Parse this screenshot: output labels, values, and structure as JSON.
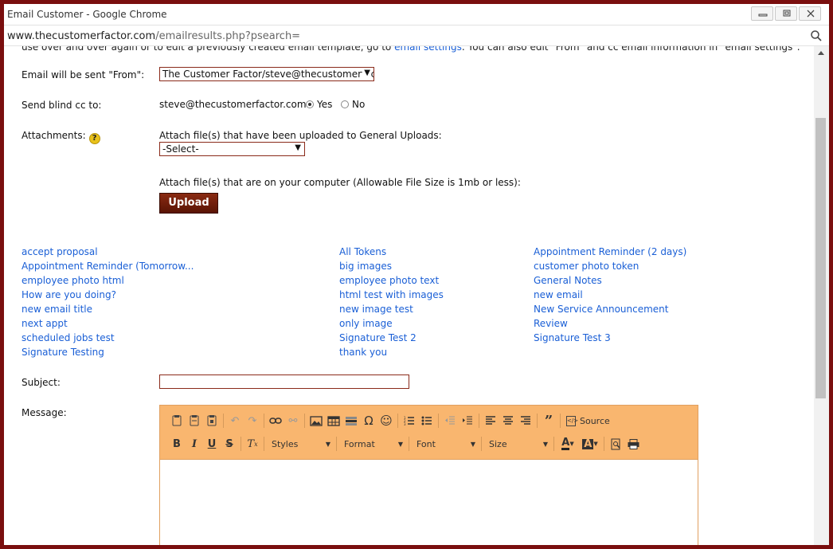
{
  "window": {
    "title": "Email Customer - Google Chrome"
  },
  "address": {
    "domain": "www.thecustomerfactor.com",
    "path": "/emailresults.php?psearch="
  },
  "intro": {
    "text": "use over and over again or to edit a previously created email template, go to ",
    "link": "email settings",
    "text2": ". You can also edit \"From\" and cc email information in \"email settings\"."
  },
  "from": {
    "label": "Email will be sent \"From\":",
    "value": "The Customer Factor/steve@thecustomerfactor.com"
  },
  "bcc": {
    "label": "Send blind cc to:",
    "email": "steve@thecustomerfactor.com",
    "yes": "Yes",
    "no": "No"
  },
  "attachments": {
    "label": "Attachments:",
    "help": "?",
    "uploaded_text": "Attach file(s) that have been uploaded to General Uploads:",
    "select_value": "-Select-",
    "computer_text": "Attach file(s) that are on your computer (Allowable File Size is 1mb or less):",
    "upload_label": "Upload"
  },
  "templates": {
    "col1": [
      "accept proposal",
      "Appointment Reminder (Tomorrow...",
      "employee photo html",
      "How are you doing?",
      "new email title",
      "next appt",
      "scheduled jobs test",
      "Signature Testing"
    ],
    "col2": [
      "All Tokens",
      "big images",
      "employee photo text",
      "html test with images",
      "new image test",
      "only image",
      "Signature Test 2",
      "thank you"
    ],
    "col3": [
      "Appointment Reminder (2 days)",
      "customer photo token",
      "General Notes",
      "new email",
      "New Service Announcement",
      "Review",
      "Signature Test 3"
    ]
  },
  "subject": {
    "label": "Subject:",
    "value": ""
  },
  "message": {
    "label": "Message:",
    "toolbar": {
      "styles": "Styles",
      "format": "Format",
      "font": "Font",
      "size": "Size",
      "source": "Source"
    }
  },
  "colors": {
    "frame": "#7a0e0e",
    "link": "#1a5fd6",
    "toolbar": "#f9b66f",
    "button": "#6e1c0a"
  }
}
